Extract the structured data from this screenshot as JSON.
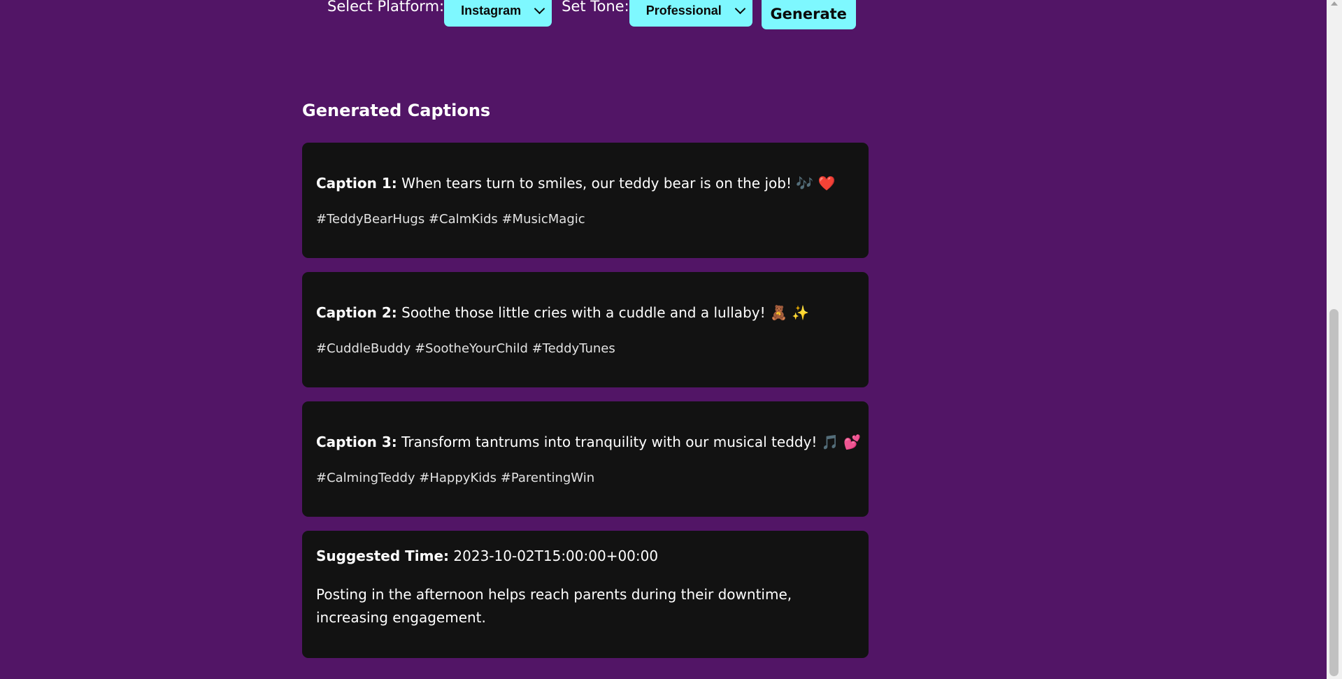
{
  "controls": {
    "platform_label": "Select Platform:",
    "platform_value": "Instagram",
    "tone_label": "Set Tone:",
    "tone_value": "Professional",
    "generate_label": "Generate"
  },
  "section_title": "Generated Captions",
  "captions": [
    {
      "label": "Caption 1:",
      "text": "When tears turn to smiles, our teddy bear is on the job! 🎶 ❤️",
      "hashtags": "#TeddyBearHugs #CalmKids #MusicMagic"
    },
    {
      "label": "Caption 2:",
      "text": "Soothe those little cries with a cuddle and a lullaby! 🧸 ✨",
      "hashtags": "#CuddleBuddy #SootheYourChild #TeddyTunes"
    },
    {
      "label": "Caption 3:",
      "text": "Transform tantrums into tranquility with our musical teddy! 🎵 💕",
      "hashtags": "#CalmingTeddy #HappyKids #ParentingWin"
    }
  ],
  "suggestion": {
    "label": "Suggested Time:",
    "time": "2023-10-02T15:00:00+00:00",
    "reason": "Posting in the afternoon helps reach parents during their downtime, increasing engagement."
  },
  "colors": {
    "background": "#521566",
    "card": "#121212",
    "accent": "#7ef8ff"
  },
  "icons": {
    "dropdown": "chevron-down-icon",
    "scroll_up": "scroll-up-arrow-icon"
  }
}
